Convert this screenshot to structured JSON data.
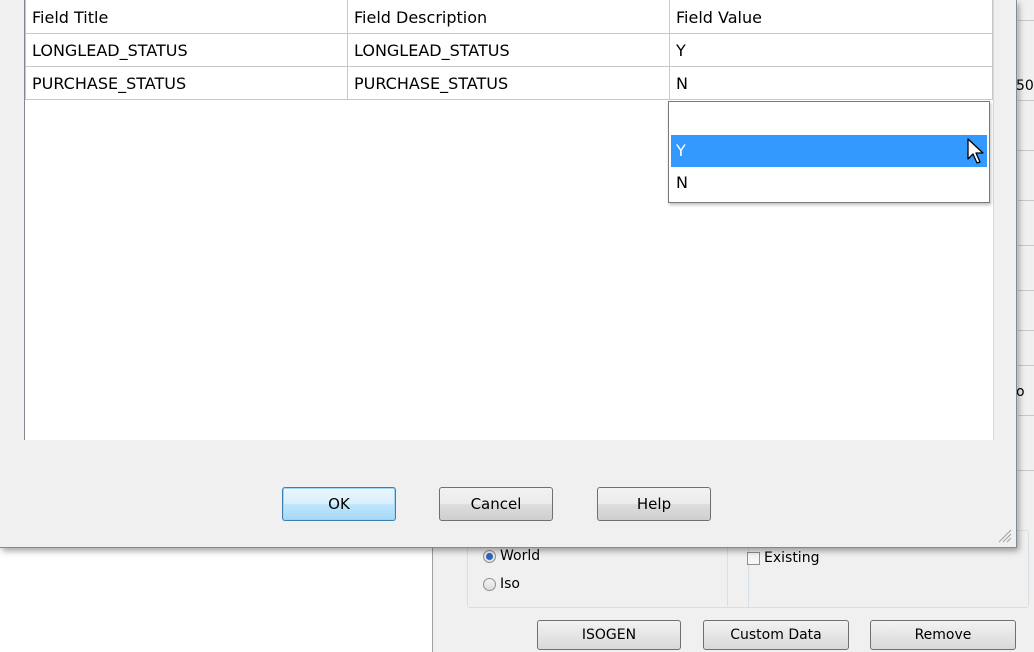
{
  "grid": {
    "headers": [
      "Field Title",
      "Field Description",
      "Field Value"
    ],
    "rows": [
      {
        "title": "LONGLEAD_STATUS",
        "description": "LONGLEAD_STATUS",
        "value": "Y"
      },
      {
        "title": "PURCHASE_STATUS",
        "description": "PURCHASE_STATUS",
        "value": "N"
      }
    ]
  },
  "dropdown": {
    "options": [
      "",
      "Y",
      "N"
    ],
    "selected": "Y"
  },
  "buttons": {
    "ok": "OK",
    "cancel": "Cancel",
    "help": "Help"
  },
  "background": {
    "fragment_top": "50",
    "fragment_mid": "o",
    "radio_world": "World",
    "radio_iso": "Iso",
    "checkbox_existing": "Existing",
    "isogen": "ISOGEN",
    "custom_data": "Custom Data",
    "remove": "Remove"
  },
  "colors": {
    "selection": "#3399ff",
    "default_button_border": "#3c7fb1",
    "editing_border": "#3a3ad0"
  },
  "icons": [
    "mouse-pointer-icon",
    "resize-grip-icon",
    "radio-checked-icon",
    "radio-unchecked-icon",
    "checkbox-icon"
  ]
}
